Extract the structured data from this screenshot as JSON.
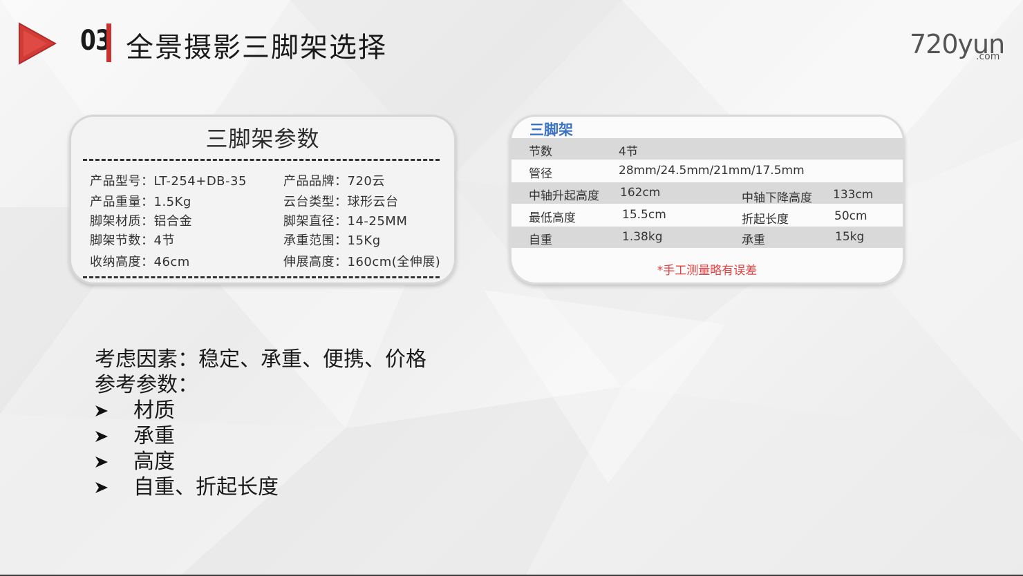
{
  "header": {
    "section_number": "03",
    "title": "全景摄影三脚架选择"
  },
  "logo": {
    "main": "720yun",
    "suffix": ".com"
  },
  "params_card": {
    "title": "三脚架参数",
    "items": [
      "产品型号：LT-254+DB-35",
      "产品品牌：720云",
      "产品重量：1.5Kg",
      "云台类型：球形云台",
      "脚架材质：铝合金",
      "脚架直径：14-25MM",
      "脚架节数：4节",
      "承重范围：15Kg",
      "收纳高度：46cm",
      "伸展高度：160cm(全伸展)"
    ]
  },
  "spec_card": {
    "title": "三脚架",
    "rows": [
      {
        "c1": "节数",
        "c2": "4节",
        "c3": "",
        "c4": ""
      },
      {
        "c1": "管径",
        "c2": "28mm/24.5mm/21mm/17.5mm",
        "c3": "",
        "c4": ""
      },
      {
        "c1": "中轴升起高度",
        "c2": "162cm",
        "c3": "中轴下降高度",
        "c4": "133cm"
      },
      {
        "c1": "最低高度",
        "c2": "15.5cm",
        "c3": "折起长度",
        "c4": "50cm"
      },
      {
        "c1": "自重",
        "c2": "1.38kg",
        "c3": "承重",
        "c4": "15kg"
      }
    ],
    "note": "*手工测量略有误差"
  },
  "factors": {
    "line1": "考虑因素：稳定、承重、便携、价格",
    "line2": "参考参数：",
    "bullets": [
      "材质",
      "承重",
      "高度",
      "自重、折起长度"
    ]
  },
  "colors": {
    "accent_red": "#c8332f",
    "title_blue": "#3a73c4",
    "note_red": "#e5413f"
  },
  "icons": {
    "section_marker": "play-triangle-icon",
    "bullet": "arrow-bullet-icon"
  }
}
